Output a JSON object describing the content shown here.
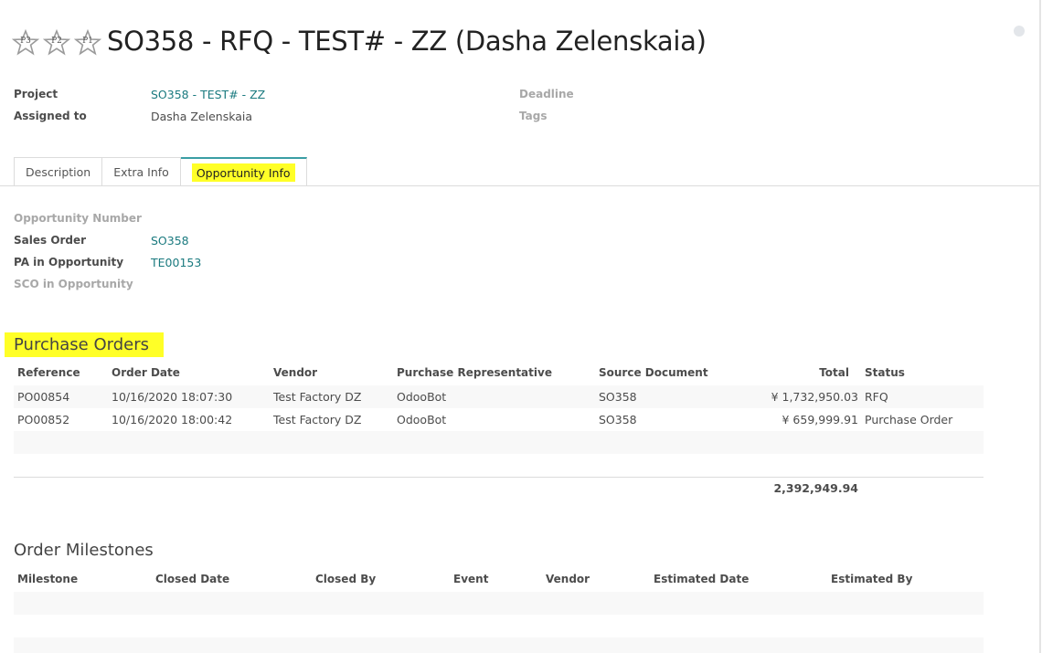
{
  "header": {
    "title": "SO358 - RFQ - TEST# - ZZ (Dasha Zelenskaia)",
    "priorities": [
      "P3",
      "P2",
      "P1"
    ]
  },
  "fields": {
    "project": {
      "label": "Project",
      "value": "SO358 - TEST# - ZZ"
    },
    "assigned_to": {
      "label": "Assigned to",
      "value": "Dasha Zelenskaia"
    },
    "deadline": {
      "label": "Deadline"
    },
    "tags": {
      "label": "Tags"
    }
  },
  "tabs": [
    {
      "label": "Description"
    },
    {
      "label": "Extra Info"
    },
    {
      "label": "Opportunity Info"
    }
  ],
  "opportunity": {
    "number": {
      "label": "Opportunity Number"
    },
    "sales_order": {
      "label": "Sales Order",
      "value": "SO358"
    },
    "pa": {
      "label": "PA in Opportunity",
      "value": "TE00153"
    },
    "sco": {
      "label": "SCO in Opportunity"
    }
  },
  "purchase_orders": {
    "title": "Purchase Orders",
    "columns": [
      "Reference",
      "Order Date",
      "Vendor",
      "Purchase Representative",
      "Source Document",
      "Total",
      "Status"
    ],
    "rows": [
      {
        "reference": "PO00854",
        "order_date": "10/16/2020 18:07:30",
        "vendor": "Test Factory DZ",
        "rep": "OdooBot",
        "source": "SO358",
        "total": "¥ 1,732,950.03",
        "status": "RFQ"
      },
      {
        "reference": "PO00852",
        "order_date": "10/16/2020 18:00:42",
        "vendor": "Test Factory DZ",
        "rep": "OdooBot",
        "source": "SO358",
        "total": "¥ 659,999.91",
        "status": "Purchase Order"
      }
    ],
    "sum_total": "2,392,949.94"
  },
  "milestones": {
    "title": "Order Milestones",
    "columns": [
      "Milestone",
      "Closed Date",
      "Closed By",
      "Event",
      "Vendor",
      "Estimated Date",
      "Estimated By"
    ]
  },
  "colors": {
    "link": "#1a7a7f",
    "highlight": "#ffff27",
    "tab_accent": "#3a9ea4"
  }
}
